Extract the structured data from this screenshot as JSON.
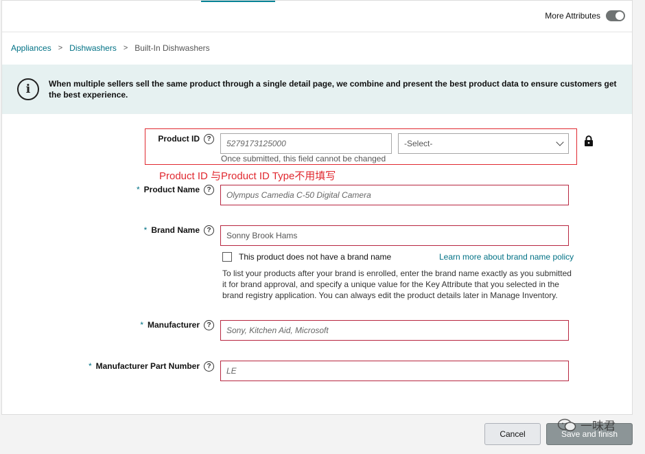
{
  "header": {
    "more_attributes_label": "More Attributes",
    "more_attributes_toggle": "off"
  },
  "breadcrumb": {
    "items": [
      "Appliances",
      "Dishwashers"
    ],
    "current": "Built-In Dishwashers",
    "separator": ">"
  },
  "info_banner": {
    "icon": "info-circle-icon",
    "text": "When multiple sellers sell the same product through a single detail page, we combine and present the best product data to ensure customers get the best experience."
  },
  "form": {
    "product_id": {
      "label": "Product ID",
      "value": "5279173125000",
      "note": "Once submitted, this field cannot be changed",
      "type_select": "-Select-"
    },
    "annotation": "Product ID 与Product ID Type不用填写",
    "product_name": {
      "required": "*",
      "label": "Product Name",
      "placeholder": "Olympus Camedia C-50 Digital Camera"
    },
    "brand_name": {
      "required": "*",
      "label": "Brand Name",
      "value": "Sonny Brook Hams",
      "no_brand_label": "This product does not have a brand name",
      "learn_more": "Learn more about brand name policy",
      "help_text": "To list your products after your brand is enrolled, enter the brand name exactly as you submitted it for brand approval, and specify a unique value for the Key Attribute that you selected in the brand registry application. You can always edit the product details later in Manage Inventory."
    },
    "manufacturer": {
      "required": "*",
      "label": "Manufacturer",
      "placeholder": "Sony, Kitchen Aid, Microsoft"
    },
    "manufacturer_part_number": {
      "required": "*",
      "label": "Manufacturer Part Number",
      "placeholder": "LE"
    },
    "help_glyph": "?"
  },
  "footer": {
    "cancel_label": "Cancel",
    "save_label": "Save and finish"
  },
  "watermark": {
    "text": "一味君"
  },
  "colors": {
    "accent": "#007185",
    "error_border": "#b7253f",
    "annotation_red": "#e0282f",
    "banner_bg": "#e6f1f1"
  }
}
